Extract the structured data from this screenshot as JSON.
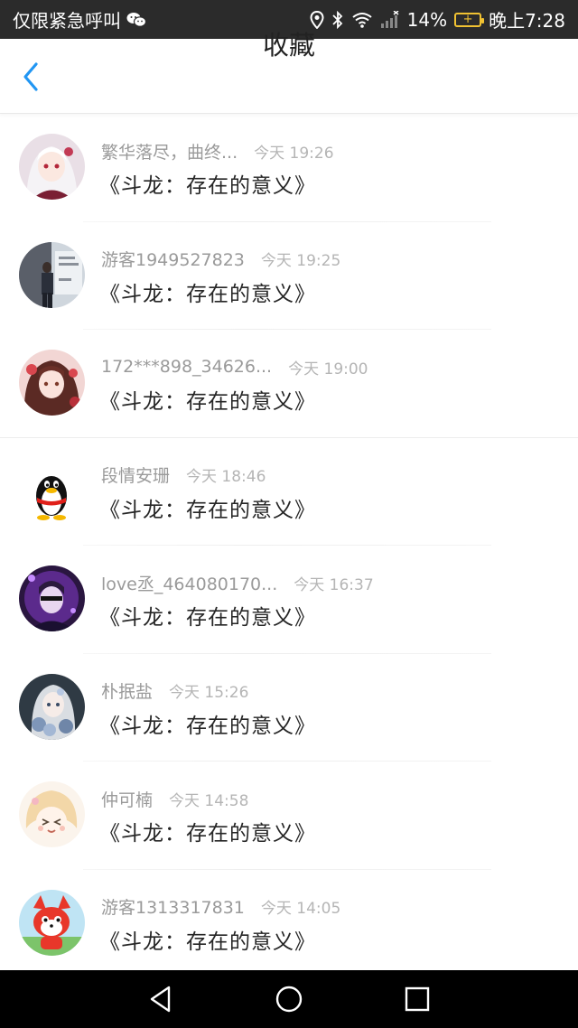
{
  "status_bar": {
    "carrier_text": "仅限紧急呼叫",
    "battery_percent": "14%",
    "time": "晚上7:28",
    "icons": [
      "wechat-icon",
      "location-icon",
      "bluetooth-icon",
      "wifi-icon",
      "signal-icon",
      "battery-charging-icon"
    ]
  },
  "header": {
    "title": "收藏",
    "back_icon": "chevron-left-icon",
    "accent_color": "#2196f3"
  },
  "items": [
    {
      "username": "繁华落尽，曲终...",
      "time": "今天 19:26",
      "title": "《斗龙：存在的意义》",
      "avatar": "anime-girl-white-hair"
    },
    {
      "username": "游客1949527823",
      "time": "今天 19:25",
      "title": "《斗龙：存在的意义》",
      "avatar": "person-photo"
    },
    {
      "username": "172***898_34626...",
      "time": "今天 19:00",
      "title": "《斗龙：存在的意义》",
      "avatar": "anime-girl-red"
    },
    {
      "username": "段情安珊",
      "time": "今天 18:46",
      "title": "《斗龙：存在的意义》",
      "avatar": "qq-penguin"
    },
    {
      "username": "love丞_464080170...",
      "time": "今天 16:37",
      "title": "《斗龙：存在的意义》",
      "avatar": "anime-boy-purple"
    },
    {
      "username": "朴抿盐",
      "time": "今天 15:26",
      "title": "《斗龙：存在的意义》",
      "avatar": "anime-girl-flowers"
    },
    {
      "username": "仲可楠",
      "time": "今天 14:58",
      "title": "《斗龙：存在的意义》",
      "avatar": "anime-chibi"
    },
    {
      "username": "游客1313317831",
      "time": "今天 14:05",
      "title": "《斗龙：存在的意义》",
      "avatar": "red-fox-cartoon"
    }
  ],
  "nav_bar": {
    "icons": [
      "back-triangle-icon",
      "home-circle-icon",
      "recents-square-icon"
    ]
  }
}
